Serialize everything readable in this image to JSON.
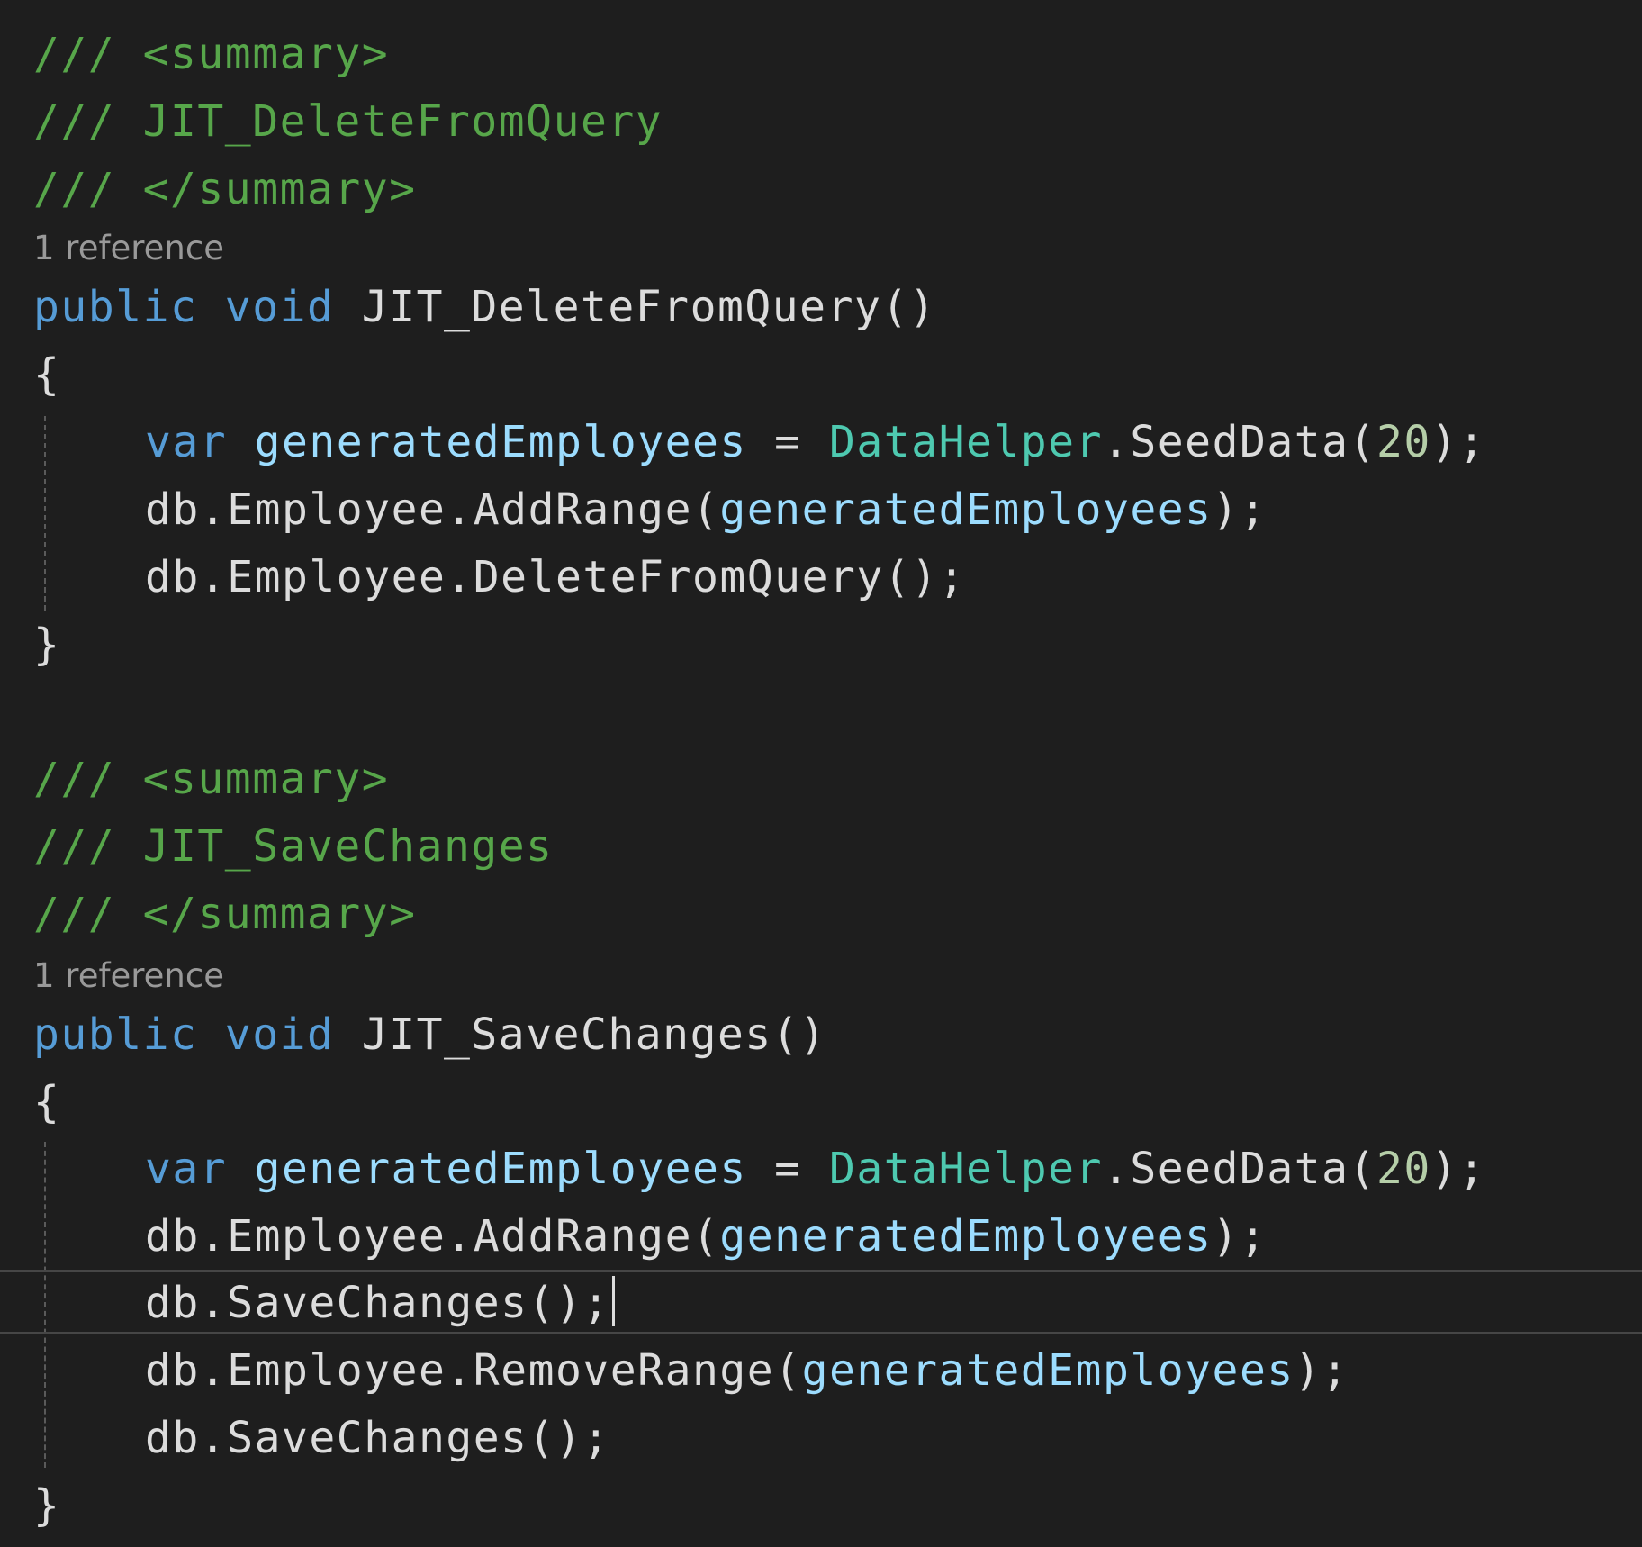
{
  "editor": {
    "block1": {
      "doc_open": "/// <summary>",
      "doc_text": "/// JIT_DeleteFromQuery",
      "doc_close": "/// </summary>",
      "codelens": "1 reference",
      "sig_public": "public",
      "sig_void": "void",
      "sig_name": "JIT_DeleteFromQuery()",
      "open_brace": "{",
      "l1_var": "var",
      "l1_name": "generatedEmployees",
      "l1_eq": " = ",
      "l1_type": "DataHelper",
      "l1_call": ".SeedData(",
      "l1_num": "20",
      "l1_end": ");",
      "l2_call": "db.Employee.AddRange(",
      "l2_arg": "generatedEmployees",
      "l2_end": ");",
      "l3": "db.Employee.DeleteFromQuery();",
      "close_brace": "}"
    },
    "block2": {
      "doc_open": "/// <summary>",
      "doc_text": "/// JIT_SaveChanges",
      "doc_close": "/// </summary>",
      "codelens": "1 reference",
      "sig_public": "public",
      "sig_void": "void",
      "sig_name": "JIT_SaveChanges()",
      "open_brace": "{",
      "l1_var": "var",
      "l1_name": "generatedEmployees",
      "l1_eq": " = ",
      "l1_type": "DataHelper",
      "l1_call": ".SeedData(",
      "l1_num": "20",
      "l1_end": ");",
      "l2_call": "db.Employee.AddRange(",
      "l2_arg": "generatedEmployees",
      "l2_end": ");",
      "l3": "db.SaveChanges();",
      "l4_call": "db.Employee.RemoveRange(",
      "l4_arg": "generatedEmployees",
      "l4_end": ");",
      "l5": "db.SaveChanges();",
      "close_brace": "}"
    }
  }
}
